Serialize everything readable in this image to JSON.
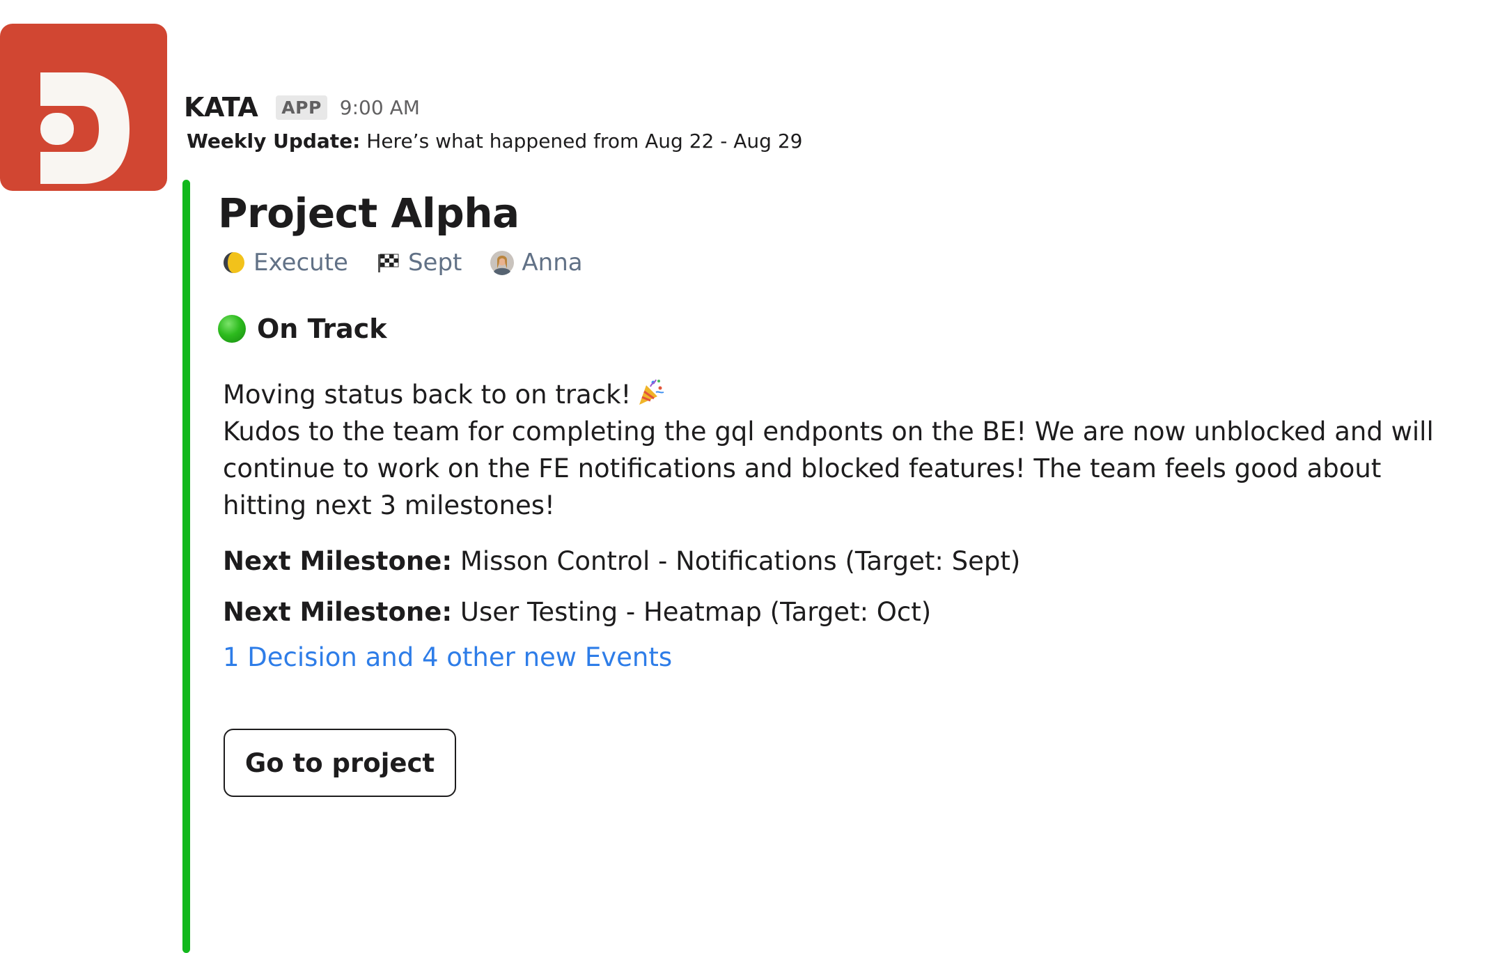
{
  "app": {
    "logo_icon": "kata-d-logo-icon",
    "brand_color": "#d14632"
  },
  "message": {
    "sender": "KATA",
    "badge": "APP",
    "time": "9:00 AM",
    "weekly_label": "Weekly Update:",
    "weekly_text": " Here’s what happened from Aug 22 - Aug 29"
  },
  "project": {
    "title": "Project Alpha",
    "accent_color": "#12b81c",
    "phase": {
      "icon": "moon-icon",
      "label": "Execute"
    },
    "target": {
      "icon": "checkered-flag-icon",
      "label": "Sept"
    },
    "owner": {
      "icon": "avatar-icon",
      "label": "Anna"
    },
    "status": {
      "icon": "green-circle-icon",
      "label": "On Track",
      "color": "#2dbb1e"
    },
    "update": {
      "line1": "Moving status back to on track!",
      "line1_icon": "party-popper-icon",
      "line2": "Kudos to the team for completing the gql endponts on the BE! We are now unblocked and will continue to work on the FE notifications and blocked features! The team feels good about hitting next 3 milestones!"
    },
    "milestones": [
      {
        "label": "Next Milestone:",
        "text": " Misson Control - Notifications (Target: Sept)"
      },
      {
        "label": "Next Milestone:",
        "text": " User Testing - Heatmap (Target: Oct)"
      }
    ],
    "events_link": "1 Decision and 4 other new Events",
    "link_color": "#2e7de8",
    "button_label": "Go to project"
  }
}
